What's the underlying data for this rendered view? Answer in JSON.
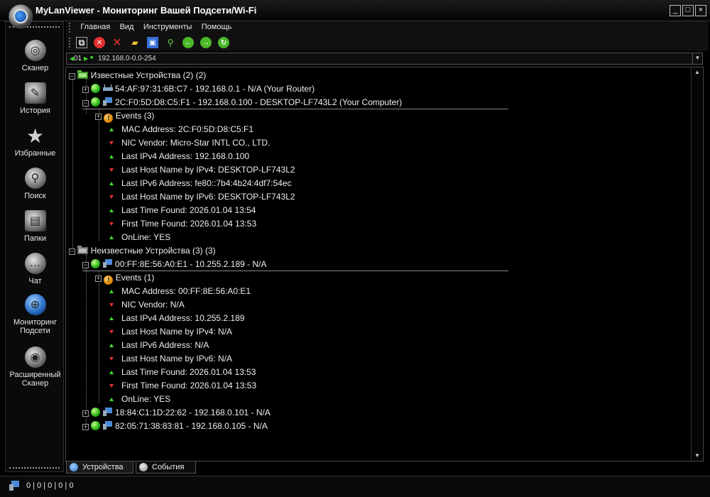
{
  "window": {
    "title": "MyLanViewer - Мониторинг Вашей Подсети/Wi-Fi",
    "controls": [
      "_",
      "□",
      "×"
    ]
  },
  "sidebar": {
    "items": [
      {
        "label": "Сканер",
        "icon": "radar-icon"
      },
      {
        "label": "История",
        "icon": "history-icon"
      },
      {
        "label": "Избранные",
        "icon": "star-icon"
      },
      {
        "label": "Поиск",
        "icon": "search-icon"
      },
      {
        "label": "Папки",
        "icon": "folders-icon"
      },
      {
        "label": "Чат",
        "icon": "chat-icon"
      },
      {
        "label": "Мониторинг Подсети",
        "line1": "Мониторинг",
        "line2": "Подсети",
        "icon": "subnet-monitor-icon",
        "active": true
      },
      {
        "label": "Расширенный Сканер",
        "line1": "Расширенный",
        "line2": "Сканер",
        "icon": "advanced-scanner-icon"
      }
    ]
  },
  "menu": {
    "items": [
      "Главная",
      "Вид",
      "Инструменты",
      "Помощь"
    ]
  },
  "toolbar": {
    "buttons": [
      "copy-icon",
      "stop-icon",
      "delete-icon",
      "open-folder-icon",
      "save-icon",
      "find-icon",
      "back-icon",
      "forward-icon",
      "refresh-icon"
    ]
  },
  "address": {
    "index": "01",
    "range": "192.168.0-0.0-254"
  },
  "tree": {
    "known": {
      "label": "Известные Устройства (2) (2)",
      "devices": [
        {
          "text": "54:AF:97:31:6B:C7 - 192.168.0.1 - N/A (Your Router)"
        },
        {
          "text": "2C:F0:5D:D8:C5:F1 - 192.168.0.100 - DESKTOP-LF743L2 (Your Computer)",
          "events": "Events (3)",
          "details": [
            {
              "text": "MAC Address: 2C:F0:5D:D8:C5:F1",
              "dir": "up"
            },
            {
              "text": "NIC Vendor: Micro-Star INTL CO., LTD.",
              "dir": "down"
            },
            {
              "text": "Last IPv4 Address: 192.168.0.100",
              "dir": "up"
            },
            {
              "text": "Last Host Name by IPv4: DESKTOP-LF743L2",
              "dir": "down"
            },
            {
              "text": "Last IPv6 Address: fe80::7b4:4b24:4df7:54ec",
              "dir": "up"
            },
            {
              "text": "Last Host Name by IPv6: DESKTOP-LF743L2",
              "dir": "down"
            },
            {
              "text": "Last Time Found: 2026.01.04  13:54",
              "dir": "up"
            },
            {
              "text": "First Time Found: 2026.01.04  13:53",
              "dir": "down"
            },
            {
              "text": "OnLine: YES",
              "dir": "up"
            }
          ]
        }
      ]
    },
    "unknown": {
      "label": "Неизвестные Устройства (3) (3)",
      "devices": [
        {
          "text": "00:FF:8E:56:A0:E1 - 10.255.2.189 - N/A",
          "events": "Events (1)",
          "details": [
            {
              "text": "MAC Address: 00:FF:8E:56:A0:E1",
              "dir": "up"
            },
            {
              "text": "NIC Vendor: N/A",
              "dir": "down"
            },
            {
              "text": "Last IPv4 Address: 10.255.2.189",
              "dir": "up"
            },
            {
              "text": "Last Host Name by IPv4: N/A",
              "dir": "down"
            },
            {
              "text": "Last IPv6 Address: N/A",
              "dir": "up"
            },
            {
              "text": "Last Host Name by IPv6: N/A",
              "dir": "down"
            },
            {
              "text": "Last Time Found: 2026.01.04  13:53",
              "dir": "up"
            },
            {
              "text": "First Time Found: 2026.01.04  13:53",
              "dir": "down"
            },
            {
              "text": "OnLine: YES",
              "dir": "up"
            }
          ]
        },
        {
          "text": "18:84:C1:1D:22:62 - 192.168.0.101 - N/A"
        },
        {
          "text": "82:05:71:38:83:81 - 192.168.0.105 - N/A"
        }
      ]
    }
  },
  "tabs": {
    "devices": "Устройства",
    "events": "События"
  },
  "status": {
    "counters": "0  |  0  |  0  |  0  |  0"
  },
  "colors": {
    "online": "#2fb81a",
    "up_arrow": "#3ddc2a",
    "down_arrow": "#e43030",
    "warning": "#e08a00"
  }
}
